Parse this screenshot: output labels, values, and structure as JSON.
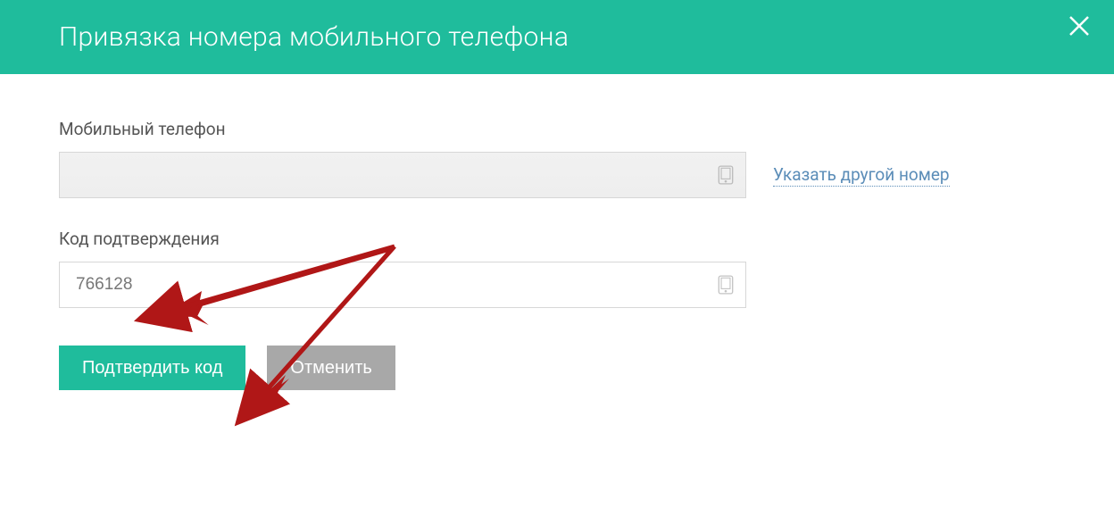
{
  "header": {
    "title": "Привязка номера мобильного телефона"
  },
  "form": {
    "phone": {
      "label": "Мобильный телефон",
      "value": "",
      "alt_link": "Указать другой номер"
    },
    "code": {
      "label": "Код подтверждения",
      "value": "766128"
    }
  },
  "buttons": {
    "confirm": "Подтвердить код",
    "cancel": "Отменить"
  },
  "colors": {
    "accent": "#1fbc9c",
    "link": "#5b8db8",
    "secondary_btn": "#a8a8a8",
    "arrow": "#b01717"
  }
}
